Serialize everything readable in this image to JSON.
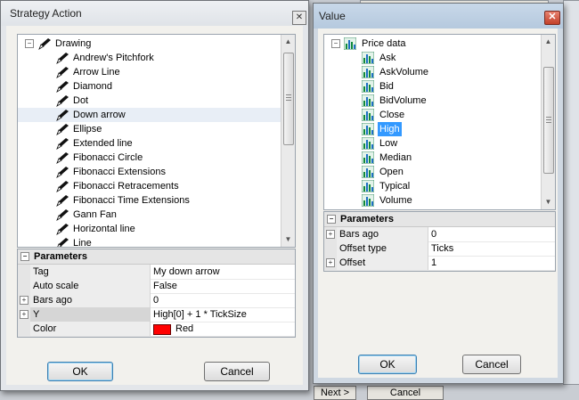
{
  "strategy_dialog": {
    "title": "Strategy Action",
    "tree": {
      "root": "Drawing",
      "items": [
        "Andrew's Pitchfork",
        "Arrow Line",
        "Diamond",
        "Dot",
        "Down arrow",
        "Ellipse",
        "Extended line",
        "Fibonacci Circle",
        "Fibonacci Extensions",
        "Fibonacci Retracements",
        "Fibonacci Time Extensions",
        "Gann Fan",
        "Horizontal line",
        "Line"
      ],
      "hovered_item": "Down arrow"
    },
    "params": {
      "header": "Parameters",
      "rows": [
        {
          "name": "Tag",
          "value": "My down arrow",
          "expandable": false
        },
        {
          "name": "Auto scale",
          "value": "False",
          "expandable": false
        },
        {
          "name": "Bars ago",
          "value": "0",
          "expandable": true
        },
        {
          "name": "Y",
          "value": "High[0] + 1 * TickSize",
          "expandable": true
        },
        {
          "name": "Color",
          "value": "Red",
          "expandable": false,
          "swatch": "#ff0000"
        }
      ]
    },
    "buttons": {
      "ok": "OK",
      "cancel": "Cancel"
    }
  },
  "value_dialog": {
    "title": "Value",
    "tree": {
      "root": "Price data",
      "items": [
        "Ask",
        "AskVolume",
        "Bid",
        "BidVolume",
        "Close",
        "High",
        "Low",
        "Median",
        "Open",
        "Typical",
        "Volume"
      ],
      "selected_item": "High"
    },
    "params": {
      "header": "Parameters",
      "rows": [
        {
          "name": "Bars ago",
          "value": "0",
          "expandable": true
        },
        {
          "name": "Offset type",
          "value": "Ticks",
          "expandable": false
        },
        {
          "name": "Offset",
          "value": "1",
          "expandable": true
        }
      ]
    },
    "buttons": {
      "ok": "OK",
      "cancel": "Cancel"
    }
  },
  "background": {
    "next_button": "Next >",
    "cancel_button": "Cancel"
  },
  "colors": {
    "selection": "#3399ff",
    "color_swatch": "#ff0000"
  }
}
